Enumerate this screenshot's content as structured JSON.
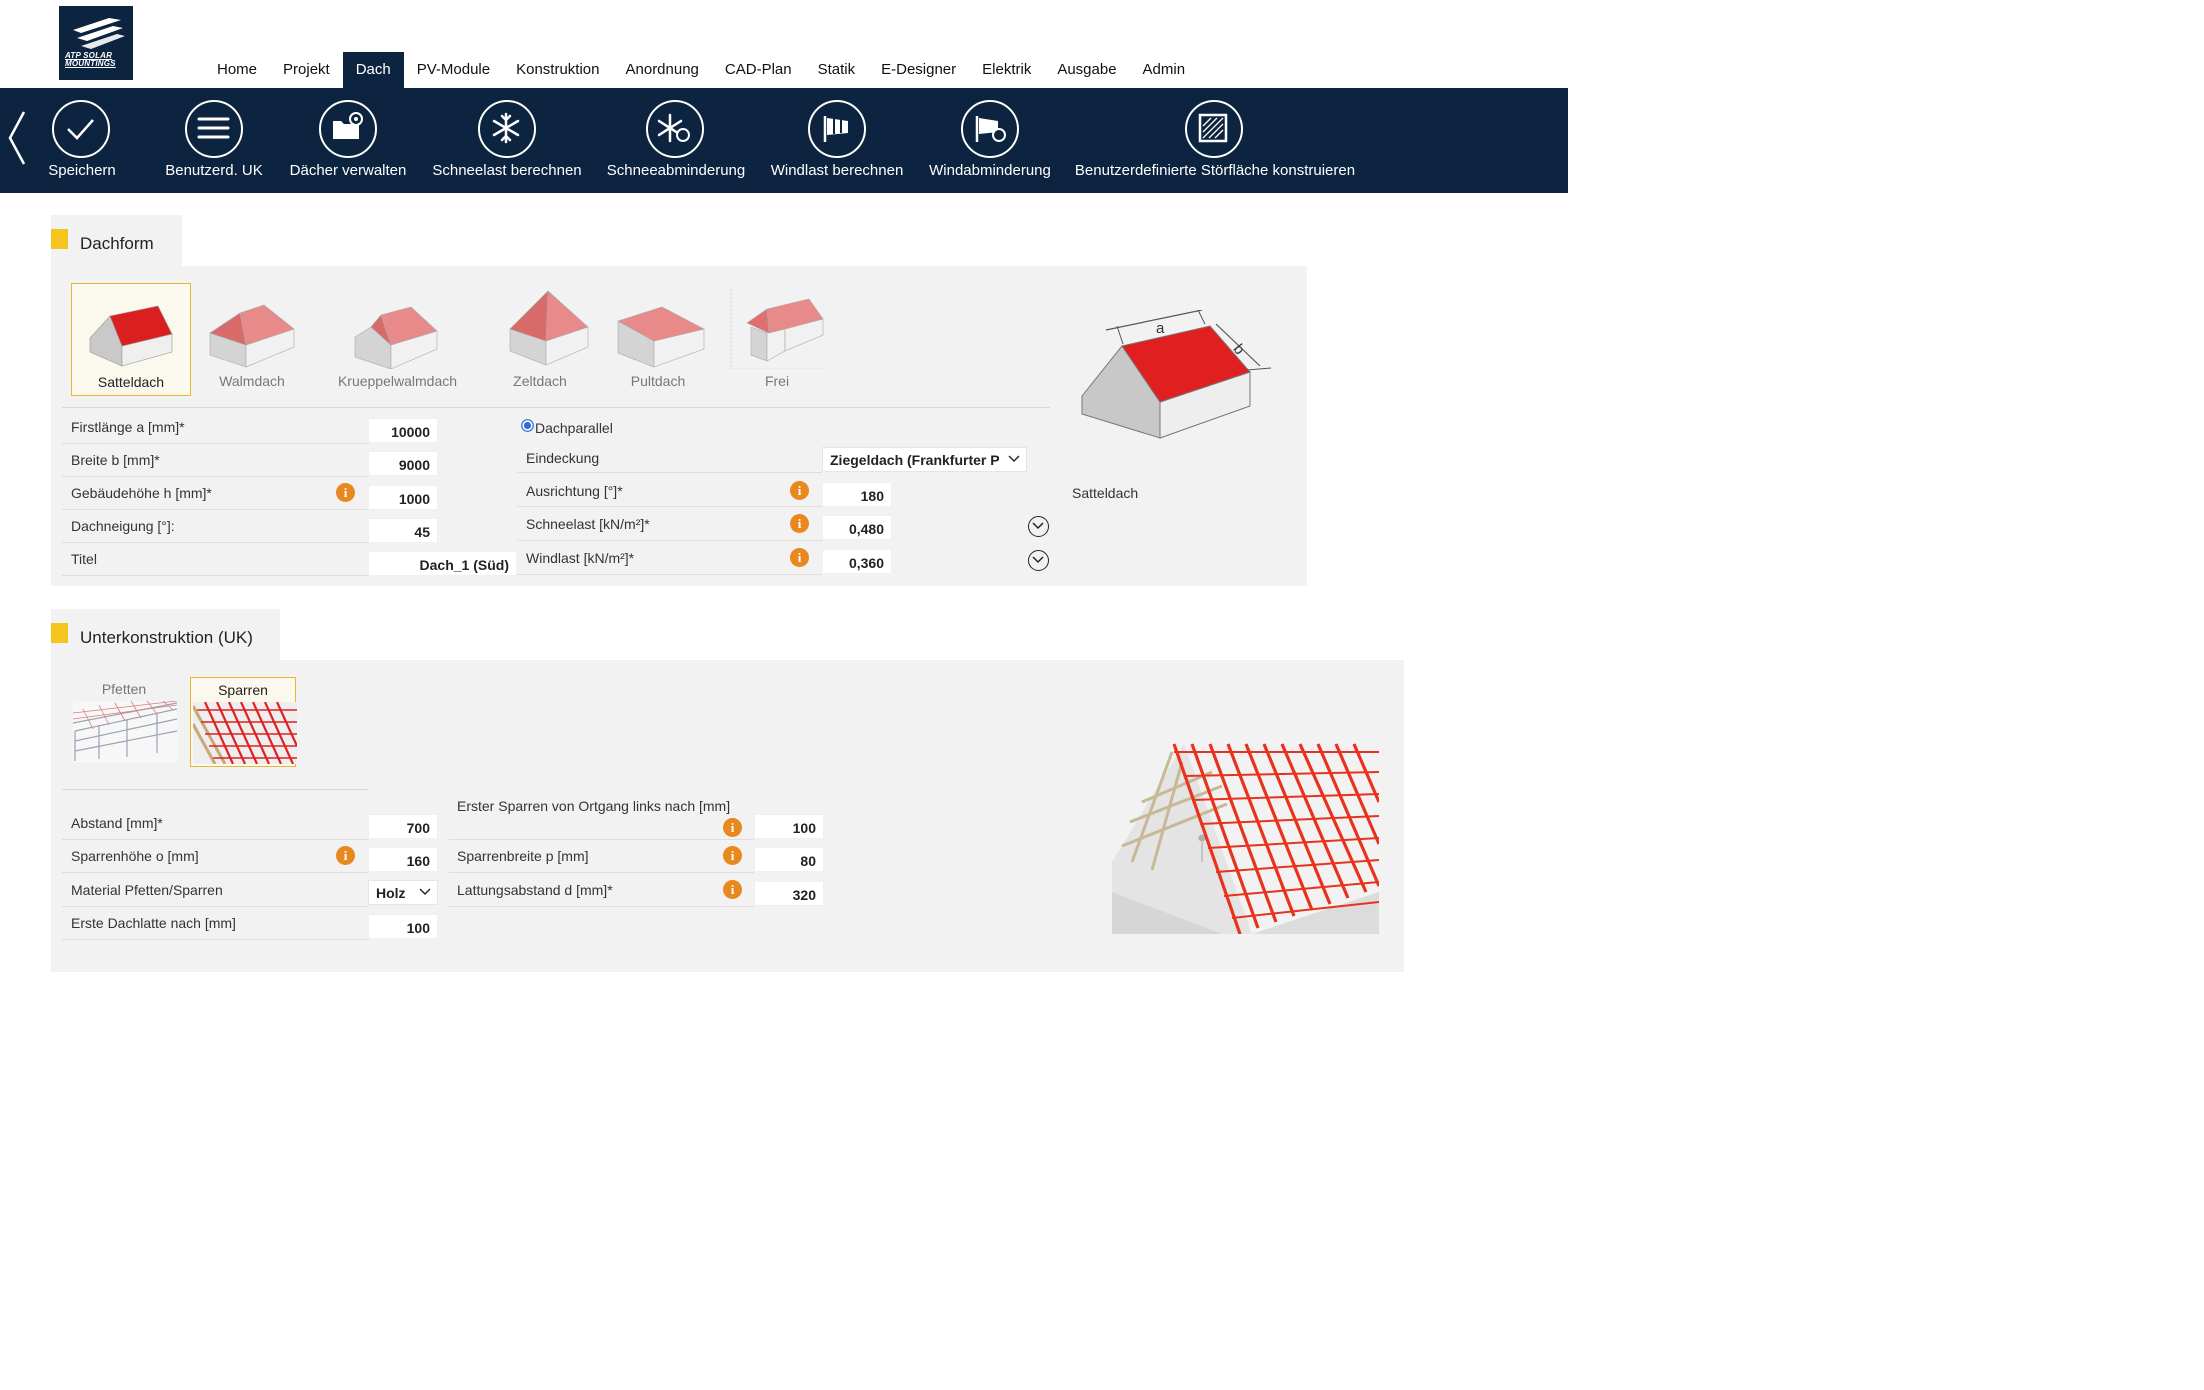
{
  "app": {
    "logo_text_1": "ATP SOLAR",
    "logo_text_2": "MOUNTINGS"
  },
  "menu": [
    {
      "label": "Home",
      "active": false
    },
    {
      "label": "Projekt",
      "active": false
    },
    {
      "label": "Dach",
      "active": true
    },
    {
      "label": "PV-Module",
      "active": false
    },
    {
      "label": "Konstruktion",
      "active": false
    },
    {
      "label": "Anordnung",
      "active": false
    },
    {
      "label": "CAD-Plan",
      "active": false
    },
    {
      "label": "Statik",
      "active": false
    },
    {
      "label": "E-Designer",
      "active": false
    },
    {
      "label": "Elektrik",
      "active": false
    },
    {
      "label": "Ausgabe",
      "active": false
    },
    {
      "label": "Admin",
      "active": false
    }
  ],
  "toolbar": [
    {
      "label": "Speichern",
      "icon": "check-icon"
    },
    {
      "label": "Benutzerd. UK",
      "icon": "list-icon"
    },
    {
      "label": "Dächer verwalten",
      "icon": "folder-gear-icon"
    },
    {
      "label": "Schneelast berechnen",
      "icon": "snowflake-icon"
    },
    {
      "label": "Schneeabminderung",
      "icon": "snowflake-gear-icon"
    },
    {
      "label": "Windlast berechnen",
      "icon": "windsock-icon"
    },
    {
      "label": "Windabminderung",
      "icon": "windsock-gear-icon"
    },
    {
      "label": "Benutzerdefinierte Störfläche konstruieren",
      "icon": "hatched-square-icon"
    }
  ],
  "dachform": {
    "title": "Dachform",
    "types": [
      {
        "label": "Satteldach",
        "selected": true
      },
      {
        "label": "Walmdach",
        "selected": false
      },
      {
        "label": "Krueppelwalmdach",
        "selected": false
      },
      {
        "label": "Zeltdach",
        "selected": false
      },
      {
        "label": "Pultdach",
        "selected": false
      },
      {
        "label": "Frei",
        "selected": false
      }
    ],
    "fields_left": [
      {
        "label": "Firstlänge a [mm]*",
        "value": "10000",
        "info": false
      },
      {
        "label": "Breite b [mm]*",
        "value": "9000",
        "info": false
      },
      {
        "label": "Gebäudehöhe h [mm]*",
        "value": "1000",
        "info": true
      },
      {
        "label": "Dachneigung [°]:",
        "value": "45",
        "info": false
      },
      {
        "label": "Titel",
        "value": "Dach_1 (Süd)",
        "info": false
      }
    ],
    "radio_label": "Dachparallel",
    "eindeckung": {
      "label": "Eindeckung",
      "value": "Ziegeldach (Frankfurter P"
    },
    "fields_right": [
      {
        "label": "Ausrichtung [°]*",
        "value": "180",
        "info": true,
        "expand": false
      },
      {
        "label": "Schneelast [kN/m²]*",
        "value": "0,480",
        "info": true,
        "expand": true
      },
      {
        "label": "Windlast [kN/m²]*",
        "value": "0,360",
        "info": true,
        "expand": true
      }
    ],
    "diagram_labels": {
      "a": "a",
      "b": "b"
    },
    "preview_caption": "Satteldach"
  },
  "uk": {
    "title": "Unterkonstruktion (UK)",
    "types": [
      {
        "label": "Pfetten",
        "selected": false
      },
      {
        "label": "Sparren",
        "selected": true
      }
    ],
    "fields_left": [
      {
        "label": "Abstand [mm]*",
        "value": "700",
        "info": false
      },
      {
        "label": "Sparrenhöhe o [mm]",
        "value": "160",
        "info": true
      },
      {
        "label": "Material Pfetten/Sparren",
        "value": "Holz",
        "select": true
      },
      {
        "label": "Erste Dachlatte nach [mm]",
        "value": "100",
        "info": false
      }
    ],
    "fields_right": [
      {
        "label": "Erster Sparren von Ortgang links nach [mm]",
        "value": "100",
        "info": true
      },
      {
        "label": "Sparrenbreite p [mm]",
        "value": "80",
        "info": true
      },
      {
        "label": "Lattungsabstand d [mm]*",
        "value": "320",
        "info": true
      }
    ]
  },
  "colors": {
    "navy": "#0d2440",
    "accent": "#f5c51e",
    "roof_red": "#e02020",
    "info_orange": "#e8891f"
  }
}
